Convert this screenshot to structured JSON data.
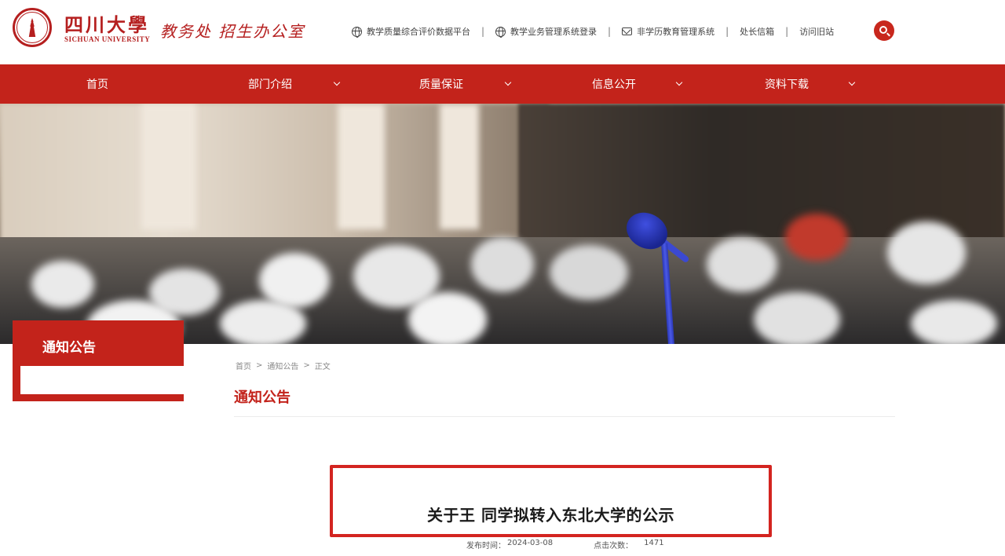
{
  "header": {
    "university_name_cn": "四川大學",
    "university_name_en": "SICHUAN UNIVERSITY",
    "department_name": "教务处 招生办公室",
    "top_links": [
      {
        "label": "教学质量综合评价数据平台",
        "icon": "globe-icon"
      },
      {
        "label": "教学业务管理系统登录",
        "icon": "globe-icon"
      },
      {
        "label": "非学历教育管理系统",
        "icon": "mail-icon"
      },
      {
        "label": "处长信箱",
        "icon": ""
      },
      {
        "label": "访问旧站",
        "icon": ""
      }
    ],
    "search_icon": "search-icon"
  },
  "nav": {
    "items": [
      {
        "label": "首页",
        "has_dropdown": false
      },
      {
        "label": "部门介绍",
        "has_dropdown": true
      },
      {
        "label": "质量保证",
        "has_dropdown": true
      },
      {
        "label": "信息公开",
        "has_dropdown": true
      },
      {
        "label": "资料下载",
        "has_dropdown": true
      }
    ]
  },
  "sidebar": {
    "title": "通知公告"
  },
  "breadcrumb": [
    "首页",
    ">",
    "通知公告",
    ">",
    "正文"
  ],
  "content": {
    "section_title": "通知公告",
    "article_title": "关于王    同学拟转入东北大学的公示",
    "meta": {
      "publish_label": "发布时间：",
      "publish_date": "2024-03-08",
      "views_label": "点击次数：",
      "views": "1471"
    }
  },
  "colors": {
    "brand_red": "#c3231b",
    "highlight_red": "#d32420"
  }
}
